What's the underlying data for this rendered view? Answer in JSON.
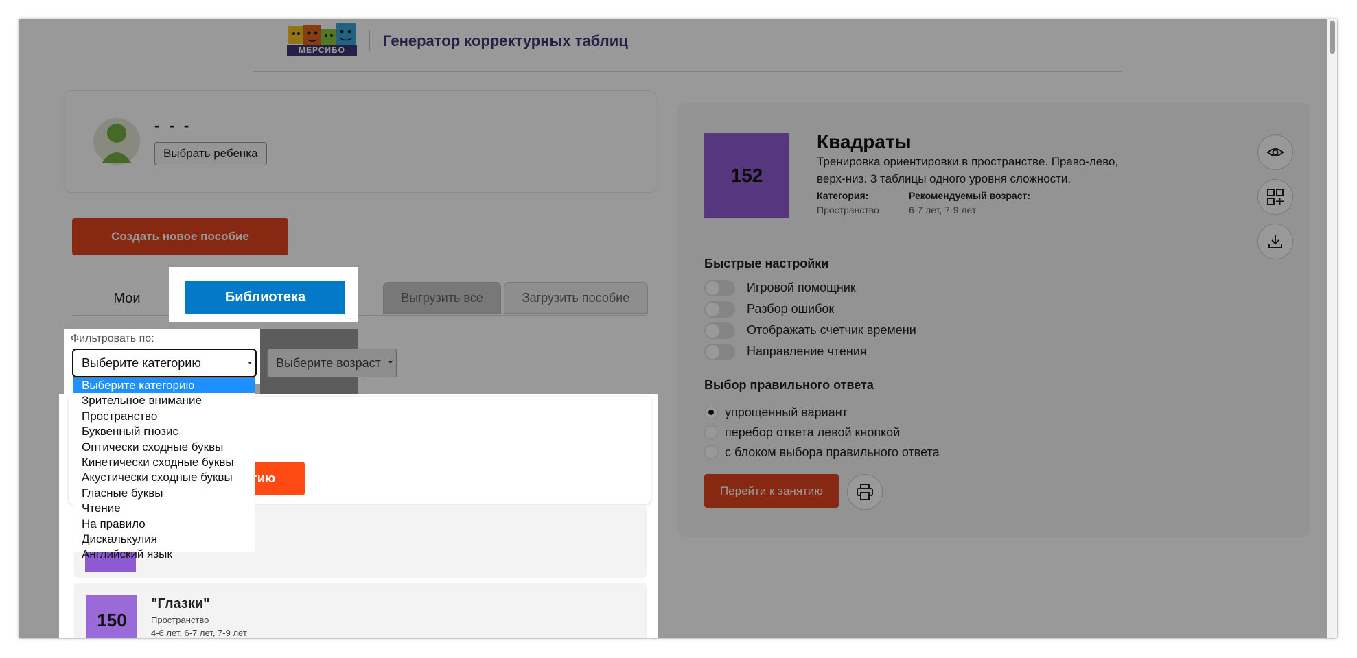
{
  "header": {
    "logo_text": "МЕРСИБО",
    "app_title": "Генератор корректурных таблиц"
  },
  "child": {
    "name": "- - -",
    "choose_label": "Выбрать ребенка"
  },
  "create_label": "Создать новое пособие",
  "tabs": {
    "mine": "Мои",
    "library": "Библиотека",
    "export": "Выгрузить все",
    "upload": "Загрузить пособие"
  },
  "filter": {
    "label": "Фильтровать по:",
    "category_value": "Выберите категорию",
    "age_value": "Выберите возраст",
    "options": [
      "Выберите категорию",
      "Зрительное внимание",
      "Пространство",
      "Буквенный гнозис",
      "Оптически сходные буквы",
      "Кинетически сходные буквы",
      "Акустически сходные буквы",
      "Гласные буквы",
      "Чтение",
      "На правило",
      "Дискалькулия",
      "Английский язык"
    ]
  },
  "list": {
    "start_partial": "тию",
    "item": {
      "number": "150",
      "title": "\"Глазки\"",
      "category": "Пространство",
      "age": "4-6 лет, 6-7 лет, 7-9 лет"
    }
  },
  "detail": {
    "number": "152",
    "title": "Квадраты",
    "description": "Тренировка ориентировки в пространстве. Право-лево, верх-низ. 3 таблицы одного уровня сложности.",
    "category_label": "Категория:",
    "category_value": "Пространство",
    "age_label": "Рекомендуемый возраст:",
    "age_value": "6-7 лет, 7-9 лет",
    "quick_settings_title": "Быстрые настройки",
    "toggles": [
      "Игровой помощник",
      "Разбор ошибок",
      "Отображать счетчик времени",
      "Направление чтения"
    ],
    "answer_title": "Выбор правильного ответа",
    "answer_options": [
      "упрощенный вариант",
      "перебор ответа левой кнопкой",
      "с блоком выбора правильного ответа"
    ],
    "goto_label": "Перейти к занятию",
    "icons": [
      "eye-icon",
      "grid-add-icon",
      "download-icon",
      "printer-icon"
    ]
  },
  "colors": {
    "accent_blue": "#0479c8",
    "accent_orange": "#e2441e",
    "brand_purple": "#3f3775",
    "thumb_purple": "#8e5ad4"
  }
}
